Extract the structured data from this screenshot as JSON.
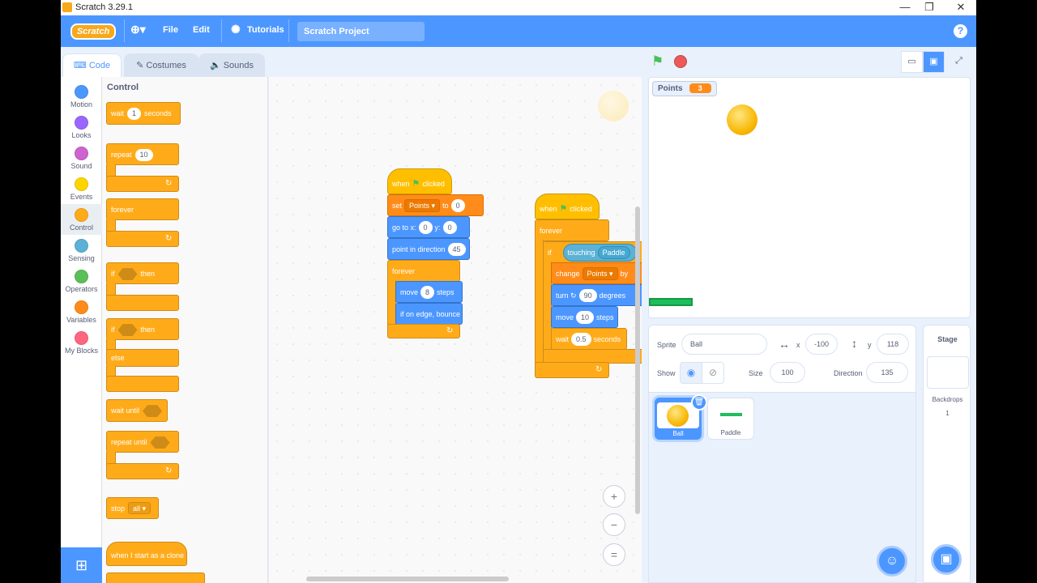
{
  "window": {
    "title": "Scratch 3.29.1",
    "min": "—",
    "max": "❐",
    "close": "✕"
  },
  "menu": {
    "logo": "Scratch",
    "file": "File",
    "edit": "Edit",
    "tutorials": "Tutorials",
    "project_title": "Scratch Project",
    "help": "?"
  },
  "tabs": {
    "code": "Code",
    "costumes": "Costumes",
    "sounds": "Sounds"
  },
  "categories": [
    {
      "label": "Motion",
      "color": "#4c97ff"
    },
    {
      "label": "Looks",
      "color": "#9966ff"
    },
    {
      "label": "Sound",
      "color": "#cf63cf"
    },
    {
      "label": "Events",
      "color": "#ffd500"
    },
    {
      "label": "Control",
      "color": "#ffab19"
    },
    {
      "label": "Sensing",
      "color": "#5cb1d6"
    },
    {
      "label": "Operators",
      "color": "#59c059"
    },
    {
      "label": "Variables",
      "color": "#ff8c1a"
    },
    {
      "label": "My Blocks",
      "color": "#ff6680"
    }
  ],
  "palette": {
    "heading": "Control",
    "wait": {
      "pre": "wait",
      "val": "1",
      "post": "seconds"
    },
    "repeat": {
      "pre": "repeat",
      "val": "10"
    },
    "forever": "forever",
    "if_then": {
      "pre": "if",
      "post": "then"
    },
    "if_else": {
      "pre": "if",
      "post": "then",
      "else": "else"
    },
    "wait_until": "wait until",
    "repeat_until": "repeat until",
    "stop": {
      "pre": "stop",
      "opt": "all"
    },
    "clone": "when I start as a clone"
  },
  "script1": {
    "hat": {
      "pre": "when",
      "post": "clicked"
    },
    "set": {
      "pre": "set",
      "var": "Points",
      "mid": "to",
      "val": "0"
    },
    "goto": {
      "pre": "go to x:",
      "x": "0",
      "mid": "y:",
      "y": "0"
    },
    "point": {
      "pre": "point in direction",
      "val": "45"
    },
    "forever": "forever",
    "move": {
      "pre": "move",
      "val": "8",
      "post": "steps"
    },
    "bounce": "if on edge, bounce"
  },
  "script2": {
    "hat": {
      "pre": "when",
      "post": "clicked"
    },
    "forever": "forever",
    "if": {
      "pre": "if",
      "sense": "touching",
      "obj": "Paddle"
    },
    "change": {
      "pre": "change",
      "var": "Points",
      "post": "by"
    },
    "turn": {
      "pre": "turn",
      "val": "90",
      "post": "degrees"
    },
    "move": {
      "pre": "move",
      "val": "10",
      "post": "steps"
    },
    "wait": {
      "pre": "wait",
      "val": "0.5",
      "post": "seconds"
    }
  },
  "monitor": {
    "label": "Points",
    "value": "3"
  },
  "sprite_info": {
    "sprite_label": "Sprite",
    "sprite_name": "Ball",
    "x_label": "x",
    "x": "-100",
    "y_label": "y",
    "y": "118",
    "show_label": "Show",
    "size_label": "Size",
    "size": "100",
    "direction_label": "Direction",
    "direction": "135"
  },
  "sprites": [
    {
      "name": "Ball"
    },
    {
      "name": "Paddle"
    }
  ],
  "stage_pane": {
    "heading": "Stage",
    "backdrops_label": "Backdrops",
    "backdrops_count": "1"
  }
}
